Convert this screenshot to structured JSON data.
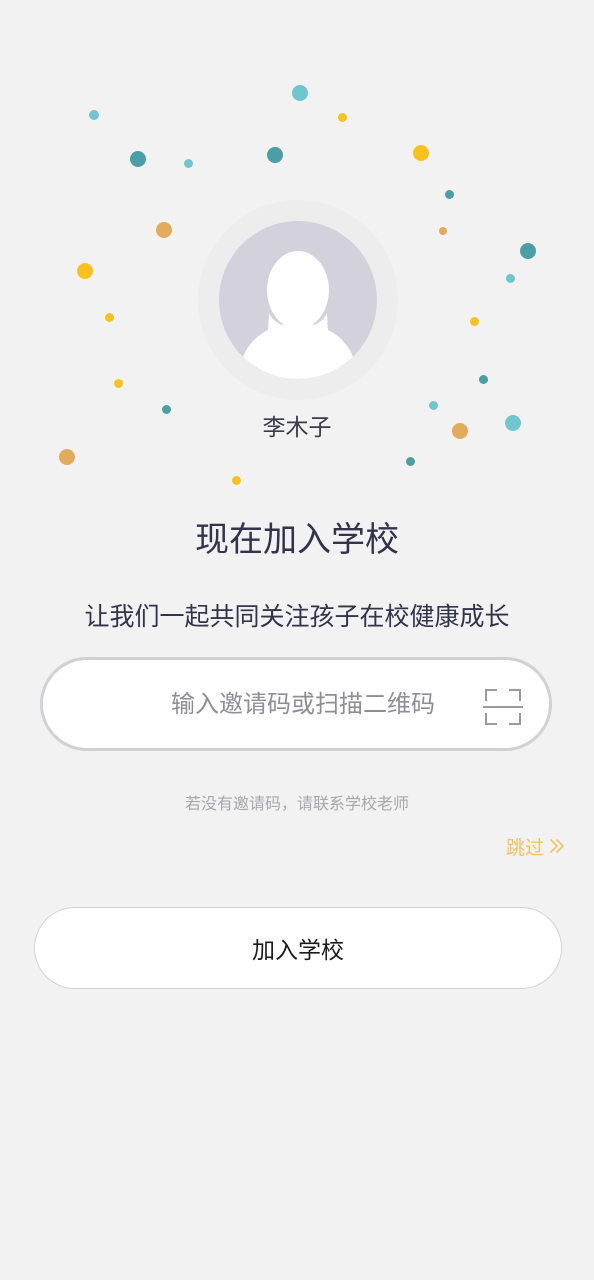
{
  "profile": {
    "name": "李木子"
  },
  "join": {
    "heading": "现在加入学校",
    "subtitle": "让我们一起共同关注孩子在校健康成长"
  },
  "invite": {
    "placeholder": "输入邀请码或扫描二维码",
    "value": "",
    "scan_icon": "qr-scan-icon"
  },
  "hint": "若没有邀请码，请联系学校老师",
  "skip": {
    "label": "跳过",
    "icon": "double-chevron-right-icon"
  },
  "actions": {
    "join_button_label": "加入学校"
  },
  "colors": {
    "background": "#f2f2f2",
    "accent_yellow": "#f3c25a",
    "dot_teal": "#4a9fa6",
    "dot_cyan": "#6fc6cf",
    "dot_yellow": "#f7c21e",
    "dot_orange": "#e3ab5c",
    "avatar_gray": "#d3d1db",
    "text_dark": "#33334a"
  }
}
